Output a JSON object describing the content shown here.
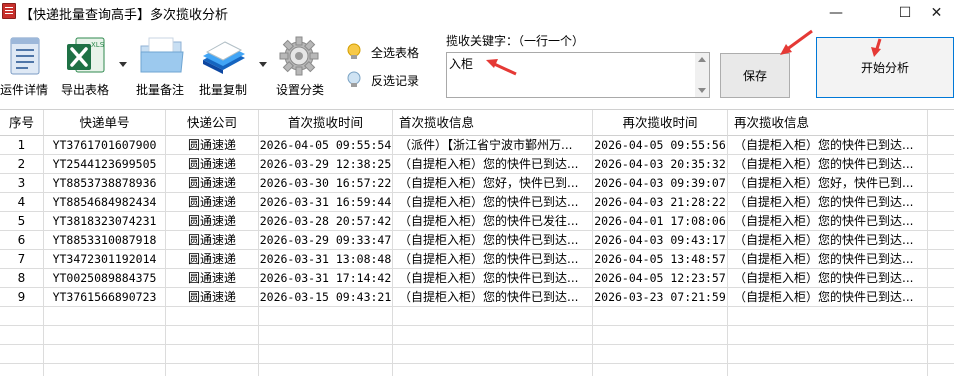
{
  "window": {
    "title": "【快递批量查询高手】多次揽收分析",
    "minimize": "—",
    "maximize": "☐",
    "close": "✕"
  },
  "toolbar": {
    "items": [
      {
        "label": "运件详情",
        "icon": "document-list-icon"
      },
      {
        "label": "导出表格",
        "icon": "excel-xls-icon"
      },
      {
        "label": "批量备注",
        "icon": "folder-icon"
      },
      {
        "label": "批量复制",
        "icon": "copy-stack-icon"
      },
      {
        "label": "设置分类",
        "icon": "gear-icon"
      }
    ],
    "select_all": "全选表格",
    "invert_select": "反选记录"
  },
  "keyword": {
    "label": "揽收关键字：（一行一个）",
    "value": "入柜"
  },
  "buttons": {
    "save": "保存",
    "start": "开始分析"
  },
  "table": {
    "columns": [
      "序号",
      "快递单号",
      "快递公司",
      "首次揽收时间",
      "首次揽收信息",
      "再次揽收时间",
      "再次揽收信息"
    ],
    "rows": [
      [
        "1",
        "YT3761701607900",
        "圆通速递",
        "2026-04-05 09:55:54",
        "（派件）【浙江省宁波市鄞州万...",
        "2026-04-05 09:55:56",
        "（自提柜入柜）您的快件已到达..."
      ],
      [
        "2",
        "YT2544123699505",
        "圆通速递",
        "2026-03-29 12:38:25",
        "（自提柜入柜）您的快件已到达...",
        "2026-04-03 20:35:32",
        "（自提柜入柜）您的快件已到达..."
      ],
      [
        "3",
        "YT8853738878936",
        "圆通速递",
        "2026-03-30 16:57:22",
        "（自提柜入柜）您好，快件已到...",
        "2026-04-03 09:39:07",
        "（自提柜入柜）您好，快件已到..."
      ],
      [
        "4",
        "YT8854684982434",
        "圆通速递",
        "2026-03-31 16:59:44",
        "（自提柜入柜）您的快件已到达...",
        "2026-04-03 21:28:22",
        "（自提柜入柜）您的快件已到达..."
      ],
      [
        "5",
        "YT3818323074231",
        "圆通速递",
        "2026-03-28 20:57:42",
        "（自提柜入柜）您的快件已发往...",
        "2026-04-01 17:08:06",
        "（自提柜入柜）您的快件已到达..."
      ],
      [
        "6",
        "YT8853310087918",
        "圆通速递",
        "2026-03-29 09:33:47",
        "（自提柜入柜）您的快件已到达...",
        "2026-04-03 09:43:17",
        "（自提柜入柜）您的快件已到达..."
      ],
      [
        "7",
        "YT3472301192014",
        "圆通速递",
        "2026-03-31 13:08:48",
        "（自提柜入柜）您的快件已到达...",
        "2026-04-05 13:48:57",
        "（自提柜入柜）您的快件已到达..."
      ],
      [
        "8",
        "YT0025089884375",
        "圆通速递",
        "2026-03-31 17:14:42",
        "（自提柜入柜）您的快件已到达...",
        "2026-04-05 12:23:57",
        "（自提柜入柜）您的快件已到达..."
      ],
      [
        "9",
        "YT3761566890723",
        "圆通速递",
        "2026-03-15 09:43:21",
        "（自提柜入柜）您的快件已到达...",
        "2026-03-23 07:21:59",
        "（自提柜入柜）您的快件已到达..."
      ]
    ]
  },
  "colors": {
    "annotation_arrow": "#e53935",
    "primary_border": "#0078d7",
    "excel_green": "#1e7145"
  }
}
